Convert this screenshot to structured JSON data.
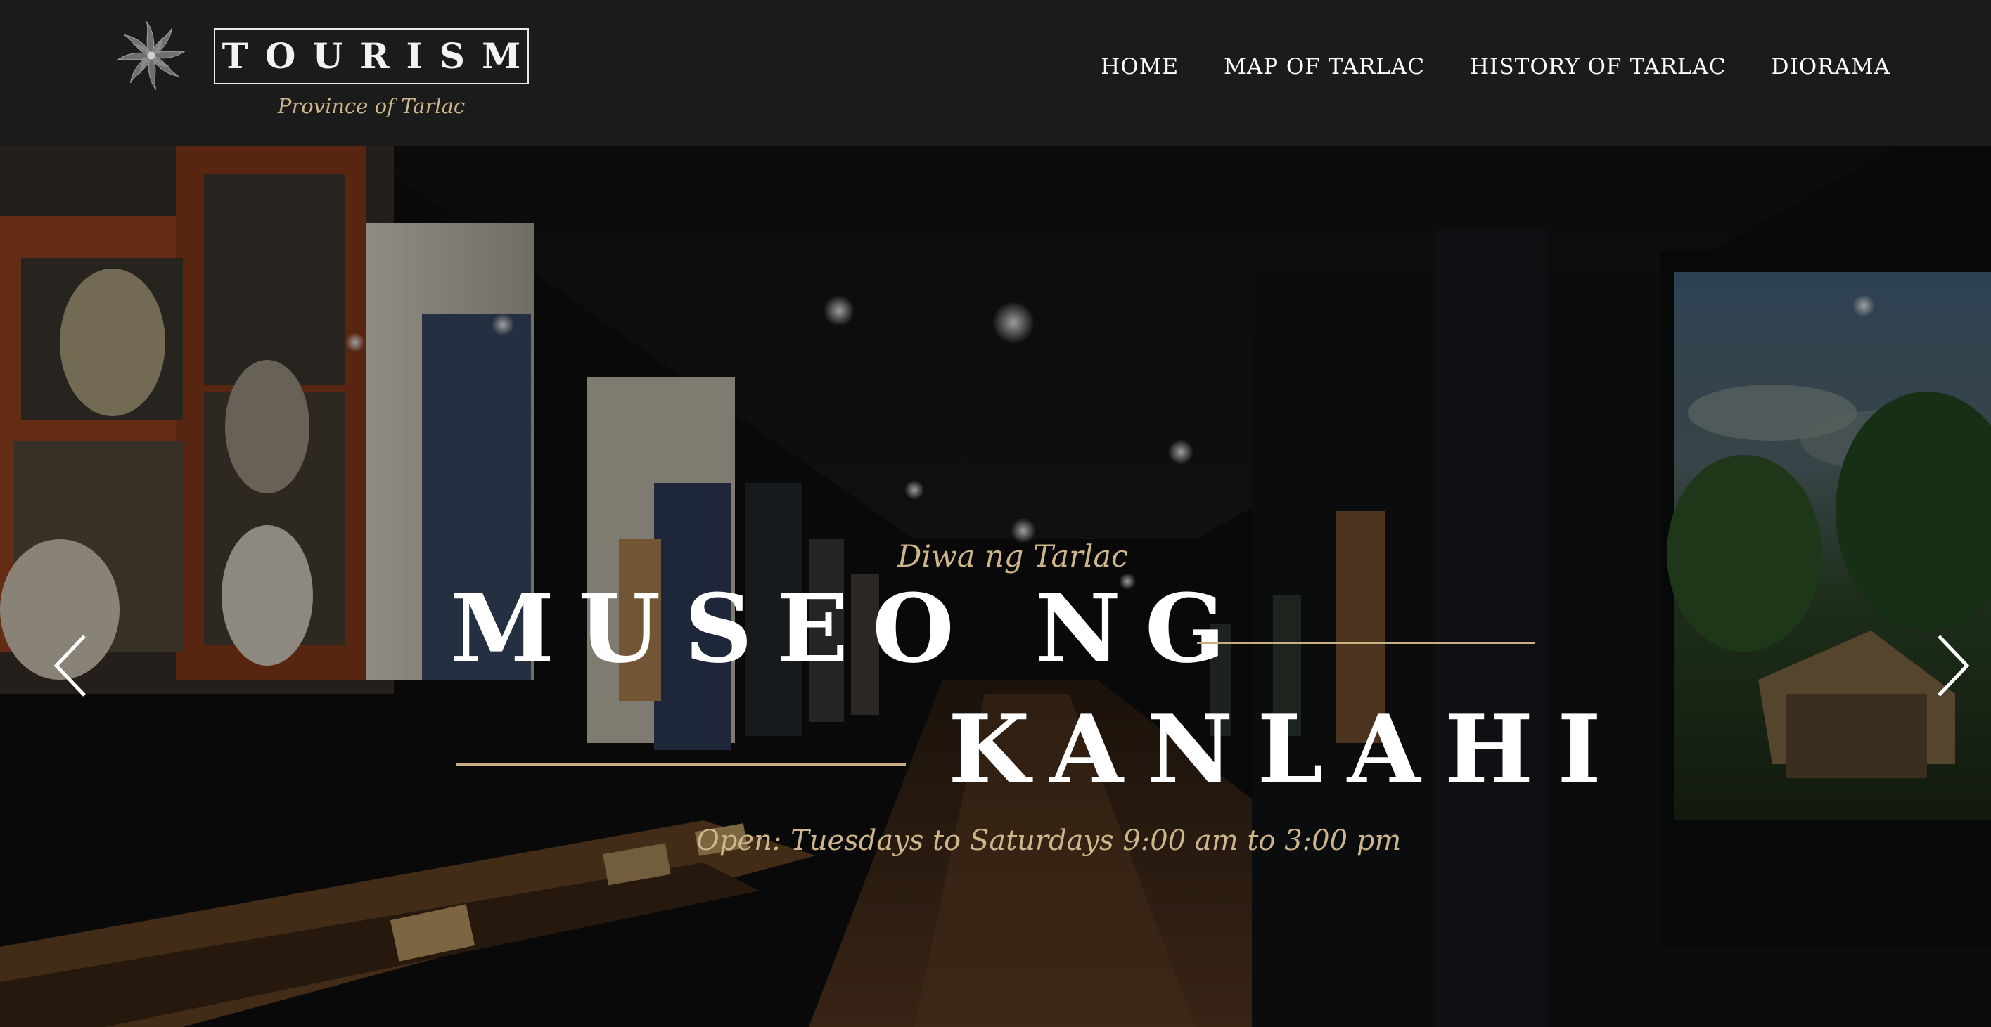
{
  "header": {
    "logo_word": "TOURISM",
    "logo_subtitle": "Province of Tarlac",
    "nav": [
      {
        "label": "HOME"
      },
      {
        "label": "MAP OF TARLAC"
      },
      {
        "label": "HISTORY OF TARLAC"
      },
      {
        "label": "DIORAMA"
      }
    ]
  },
  "hero": {
    "eyebrow": "Diwa ng Tarlac",
    "title_line1": "MUSEO NG",
    "title_line2": "KANLAHI",
    "hours": "Open: Tuesdays to Saturdays 9:00 am to 3:00 pm",
    "accent_color": "#cdb58c",
    "prev_icon": "chevron-left-icon",
    "next_icon": "chevron-right-icon"
  }
}
